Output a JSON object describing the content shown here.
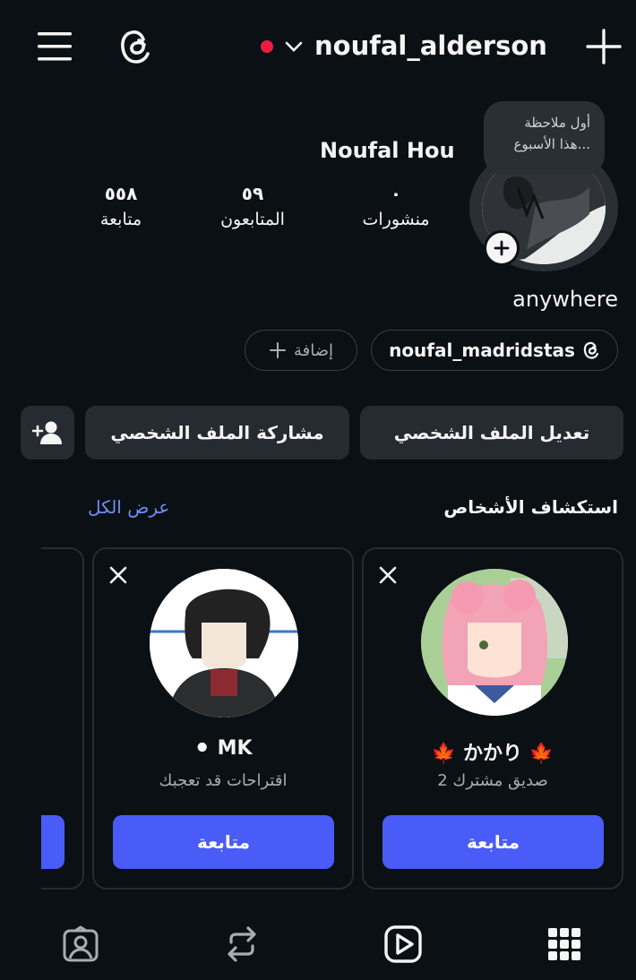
{
  "header": {
    "username": "noufal_alderson",
    "menu_icon": "hamburger-menu-icon",
    "logo_icon": "threads-logo-icon",
    "create_icon": "plus-icon"
  },
  "profile": {
    "display_name": "Noufal Hou",
    "note_bubble": "أول ملاحظة\nهذا الأسبوع...",
    "bio": "anywhere",
    "stats": [
      {
        "value": "٠",
        "label": "منشورات"
      },
      {
        "value": "٥٩",
        "label": "المتابعون"
      },
      {
        "value": "٥٥٨",
        "label": "متابعة"
      }
    ],
    "threads_link": "noufal_madridstas",
    "add_link_label": "إضافة"
  },
  "actions": {
    "edit_profile": "تعديل الملف الشخصي",
    "share_profile": "مشاركة الملف الشخصي"
  },
  "discover": {
    "title": "استكشاف الأشخاص",
    "see_all": "عرض الكل",
    "cards": [
      {
        "name": "かかり",
        "emoji": "🍁",
        "subtitle": "2 صديق مشترك",
        "follow": "متابعة"
      },
      {
        "name": "MK",
        "emoji": "⚫",
        "subtitle": "اقتراحات قد تعجبك",
        "follow": "متابعة"
      }
    ]
  },
  "tabs": [
    "tagged-icon",
    "reposts-icon",
    "reels-icon",
    "grid-icon"
  ],
  "colors": {
    "background": "#0b1014",
    "button": "#262b31",
    "accent": "#4a5cf7",
    "link": "#6f8cf7",
    "status_dot": "#ee1d40"
  }
}
